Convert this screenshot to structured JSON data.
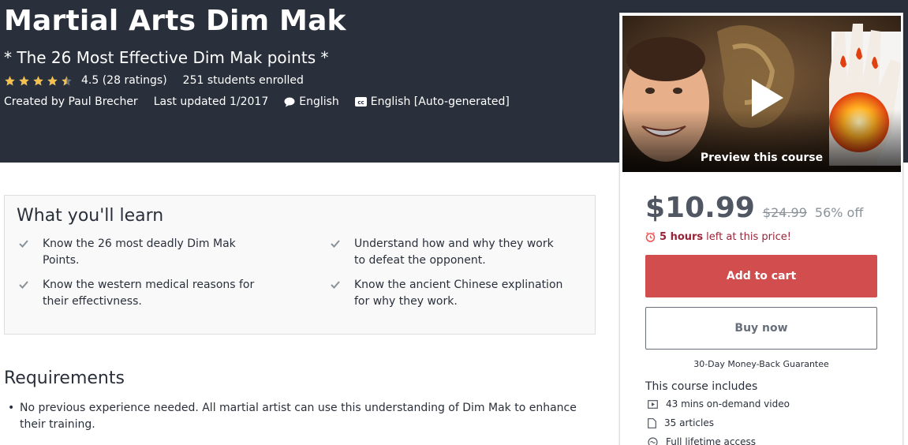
{
  "course": {
    "title": "Martial Arts Dim Mak",
    "subtitle": "* The 26 Most Effective Dim Mak points *",
    "rating": 4.5,
    "rating_text": "4.5 (28 ratings)",
    "enrolled_text": "251 students enrolled",
    "created_by": "Created by Paul Brecher",
    "last_updated": "Last updated 1/2017",
    "language": "English",
    "captions": "English [Auto-generated]"
  },
  "learn": {
    "title": "What you'll learn",
    "items": [
      {
        "text": "Know the 26 most deadly Dim Mak Points."
      },
      {
        "text": "Understand how and why they work to defeat the opponent."
      },
      {
        "text": "Know the western medical reasons for their effectivness."
      },
      {
        "text": "Know the ancient Chinese explination for why they work."
      }
    ]
  },
  "requirements": {
    "title": "Requirements",
    "items": [
      {
        "text": "No previous experience needed. All martial artist can use this understanding of Dim Mak to enhance their training."
      }
    ]
  },
  "sidebar": {
    "preview_label": "Preview this course",
    "price": "$10.99",
    "original_price": "$24.99",
    "discount": "56% off",
    "time_left_bold": "5 hours",
    "time_left_rest": "left at this price!",
    "add_to_cart": "Add to cart",
    "buy_now": "Buy now",
    "guarantee": "30-Day Money-Back Guarantee",
    "includes_title": "This course includes",
    "includes": [
      {
        "icon": "video-icon",
        "text": "43 mins on-demand video"
      },
      {
        "icon": "article-icon",
        "text": "35 articles"
      },
      {
        "icon": "lifetime-access-icon",
        "text": "Full lifetime access"
      }
    ]
  },
  "colors": {
    "hero_bg": "#29303b",
    "cart_button": "#d24e4e",
    "star": "#f4c150",
    "timer": "#992337"
  }
}
